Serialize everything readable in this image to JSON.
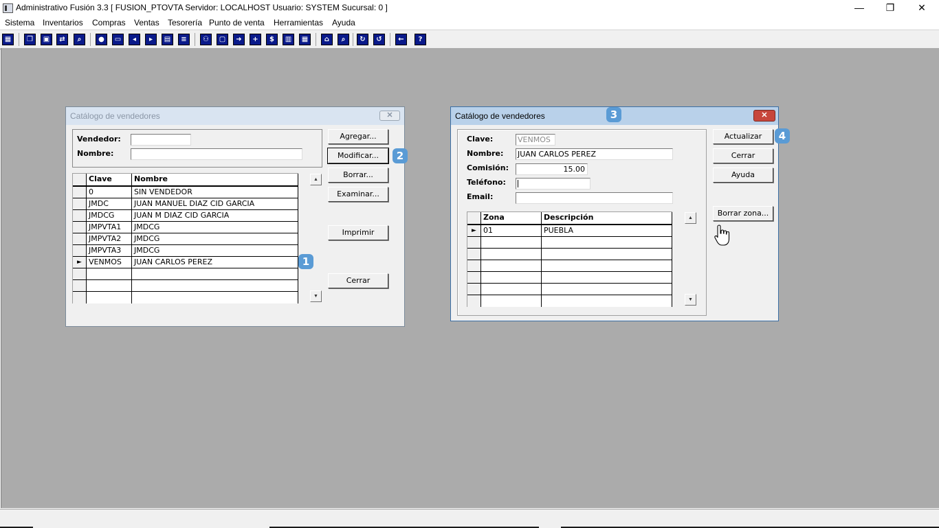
{
  "window": {
    "title": "Administrativo Fusión 3.3 [ FUSION_PTOVTA  Servidor: LOCALHOST  Usuario: SYSTEM    Sucursal: 0 ]",
    "minimize": "—",
    "restore": "❐",
    "close": "✕"
  },
  "menu": [
    "Sistema",
    "Inventarios",
    "Compras",
    "Ventas",
    "Tesorería",
    "Punto de venta",
    "Herramientas",
    "Ayuda"
  ],
  "toolbar_icons": [
    "calculator-icon",
    "copy-icon",
    "paste-icon",
    "transfer-icon",
    "search-icon",
    "user-icon",
    "folder-icon",
    "truck-in-icon",
    "truck-out-icon",
    "document-icon",
    "list-icon",
    "people-icon",
    "box-icon",
    "export-icon",
    "add-icon",
    "dollar-icon",
    "report-icon",
    "table-icon",
    "home-icon",
    "zoom-icon",
    "refresh-icon",
    "undo-icon",
    "back-icon",
    "help-icon"
  ],
  "dialog1": {
    "title": "Catálogo de vendedores",
    "close": "✕",
    "vendedor_label": "Vendedor:",
    "vendedor_value": "",
    "nombre_label": "Nombre:",
    "nombre_value": "",
    "grid_headers": [
      "Clave",
      "Nombre"
    ],
    "rows": [
      {
        "clave": "0",
        "nombre": "SIN VENDEDOR"
      },
      {
        "clave": "JMDC",
        "nombre": "JUAN MANUEL DIAZ CID GARCIA"
      },
      {
        "clave": "JMDCG",
        "nombre": "JUAN M DIAZ CID GARCIA"
      },
      {
        "clave": "JMPVTA1",
        "nombre": "JMDCG"
      },
      {
        "clave": "JMPVTA2",
        "nombre": "JMDCG"
      },
      {
        "clave": "JMPVTA3",
        "nombre": "JMDCG"
      },
      {
        "clave": "VENMOS",
        "nombre": "JUAN CARLOS PEREZ"
      }
    ],
    "current_row_marker": "►",
    "buttons": {
      "agregar": "Agregar...",
      "modificar": "Modificar...",
      "borrar": "Borrar...",
      "examinar": "Examinar...",
      "imprimir": "Imprimir",
      "cerrar": "Cerrar"
    }
  },
  "dialog2": {
    "title": "Catálogo de vendedores",
    "close": "✕",
    "clave_label": "Clave:",
    "clave_value": "VENMOS",
    "nombre_label": "Nombre:",
    "nombre_value": "JUAN CARLOS PEREZ",
    "comision_label": "Comisión:",
    "comision_value": "15.00",
    "telefono_label": "Teléfono:",
    "telefono_value": "",
    "email_label": "Email:",
    "email_value": "",
    "grid_headers": [
      "Zona",
      "Descripción"
    ],
    "rows": [
      {
        "zona": "01",
        "descripcion": "PUEBLA"
      }
    ],
    "current_row_marker": "►",
    "buttons": {
      "actualizar": "Actualizar",
      "cerrar": "Cerrar",
      "ayuda": "Ayuda",
      "borrar_zona": "Borrar zona..."
    }
  },
  "badges": [
    "1",
    "2",
    "3",
    "4"
  ],
  "colors": {
    "workspace": "#ababab",
    "badge": "#5a9bd5",
    "close_red": "#c7463c",
    "toolbar_icon": "#0a1a8a"
  }
}
